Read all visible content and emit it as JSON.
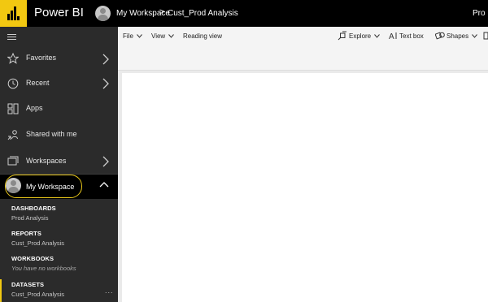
{
  "app": {
    "title": "Power BI",
    "brand_color": "#f2c811"
  },
  "header": {
    "breadcrumb": {
      "workspace": "My Workspace",
      "separator": ">",
      "item": "Cust_Prod Analysis"
    },
    "right_label": "Pro"
  },
  "sidebar": {
    "menu_icon": "hamburger-icon",
    "items": [
      {
        "label": "Favorites",
        "icon": "star-icon",
        "has_chevron": true
      },
      {
        "label": "Recent",
        "icon": "clock-icon",
        "has_chevron": true
      },
      {
        "label": "Apps",
        "icon": "apps-icon",
        "has_chevron": false
      },
      {
        "label": "Shared with me",
        "icon": "shared-icon",
        "has_chevron": false
      },
      {
        "label": "Workspaces",
        "icon": "workspaces-icon",
        "has_chevron": true
      }
    ],
    "my_workspace": {
      "label": "My Workspace",
      "expanded": true,
      "highlight_color": "#e8c61a",
      "sections": [
        {
          "title": "DASHBOARDS",
          "items": [
            "Prod Analysis"
          ]
        },
        {
          "title": "REPORTS",
          "items": [
            "Cust_Prod Analysis"
          ]
        },
        {
          "title": "WORKBOOKS",
          "items": [
            "You have no workbooks"
          ]
        },
        {
          "title": "DATASETS",
          "items": [
            "Cust_Prod Analysis"
          ]
        }
      ],
      "more_label": "..."
    }
  },
  "toolbar": {
    "left": [
      {
        "label": "File",
        "dropdown": true
      },
      {
        "label": "View",
        "dropdown": true
      },
      {
        "label": "Reading view",
        "dropdown": false
      }
    ],
    "right": [
      {
        "label": "Explore",
        "icon": "explore-icon",
        "dropdown": true
      },
      {
        "label": "Text box",
        "icon": "text-box-icon",
        "dropdown": false
      },
      {
        "label": "Shapes",
        "icon": "shapes-icon",
        "dropdown": true
      }
    ]
  }
}
